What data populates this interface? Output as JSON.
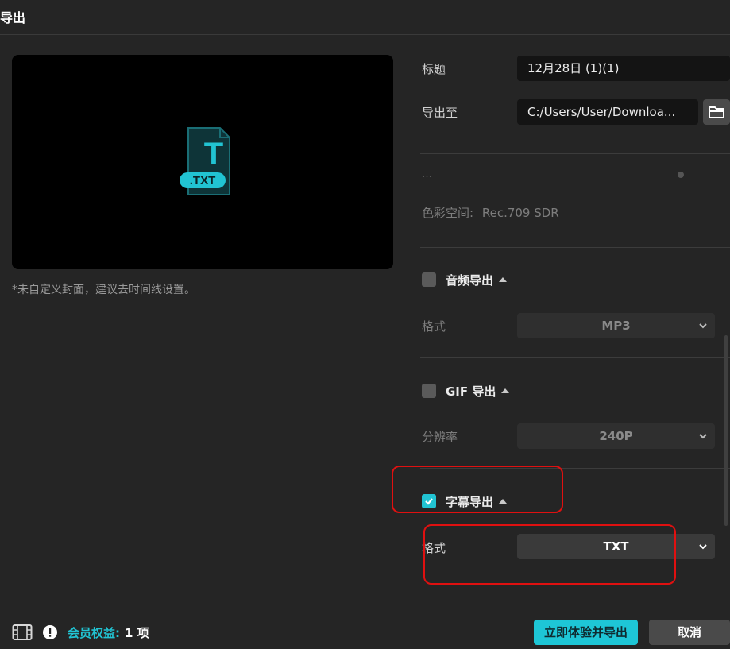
{
  "window": {
    "title": "导出"
  },
  "preview": {
    "file_badge": ".TXT",
    "file_letter": "T",
    "cover_note": "*未自定义封面，建议去时间线设置。"
  },
  "settings": {
    "title_label": "标题",
    "title_value": "12月28日 (1)(1)",
    "export_to_label": "导出至",
    "export_path": "C:/Users/User/Downloa...",
    "faded_row": "…",
    "color_space_label": "色彩空间:",
    "color_space_value": "Rec.709 SDR"
  },
  "audio_export": {
    "title": "音频导出",
    "checked": false,
    "format_label": "格式",
    "format_value": "MP3"
  },
  "gif_export": {
    "title": "GIF 导出",
    "checked": false,
    "resolution_label": "分辨率",
    "resolution_value": "240P"
  },
  "subtitle_export": {
    "title": "字幕导出",
    "checked": true,
    "format_label": "格式",
    "format_value": "TXT"
  },
  "footer": {
    "member_label": "会员权益:",
    "member_count": "1 项",
    "primary_button": "立即体验并导出",
    "cancel_button": "取消"
  },
  "colors": {
    "accent": "#21c3d2",
    "annotation": "#e01010",
    "background": "#252525"
  }
}
